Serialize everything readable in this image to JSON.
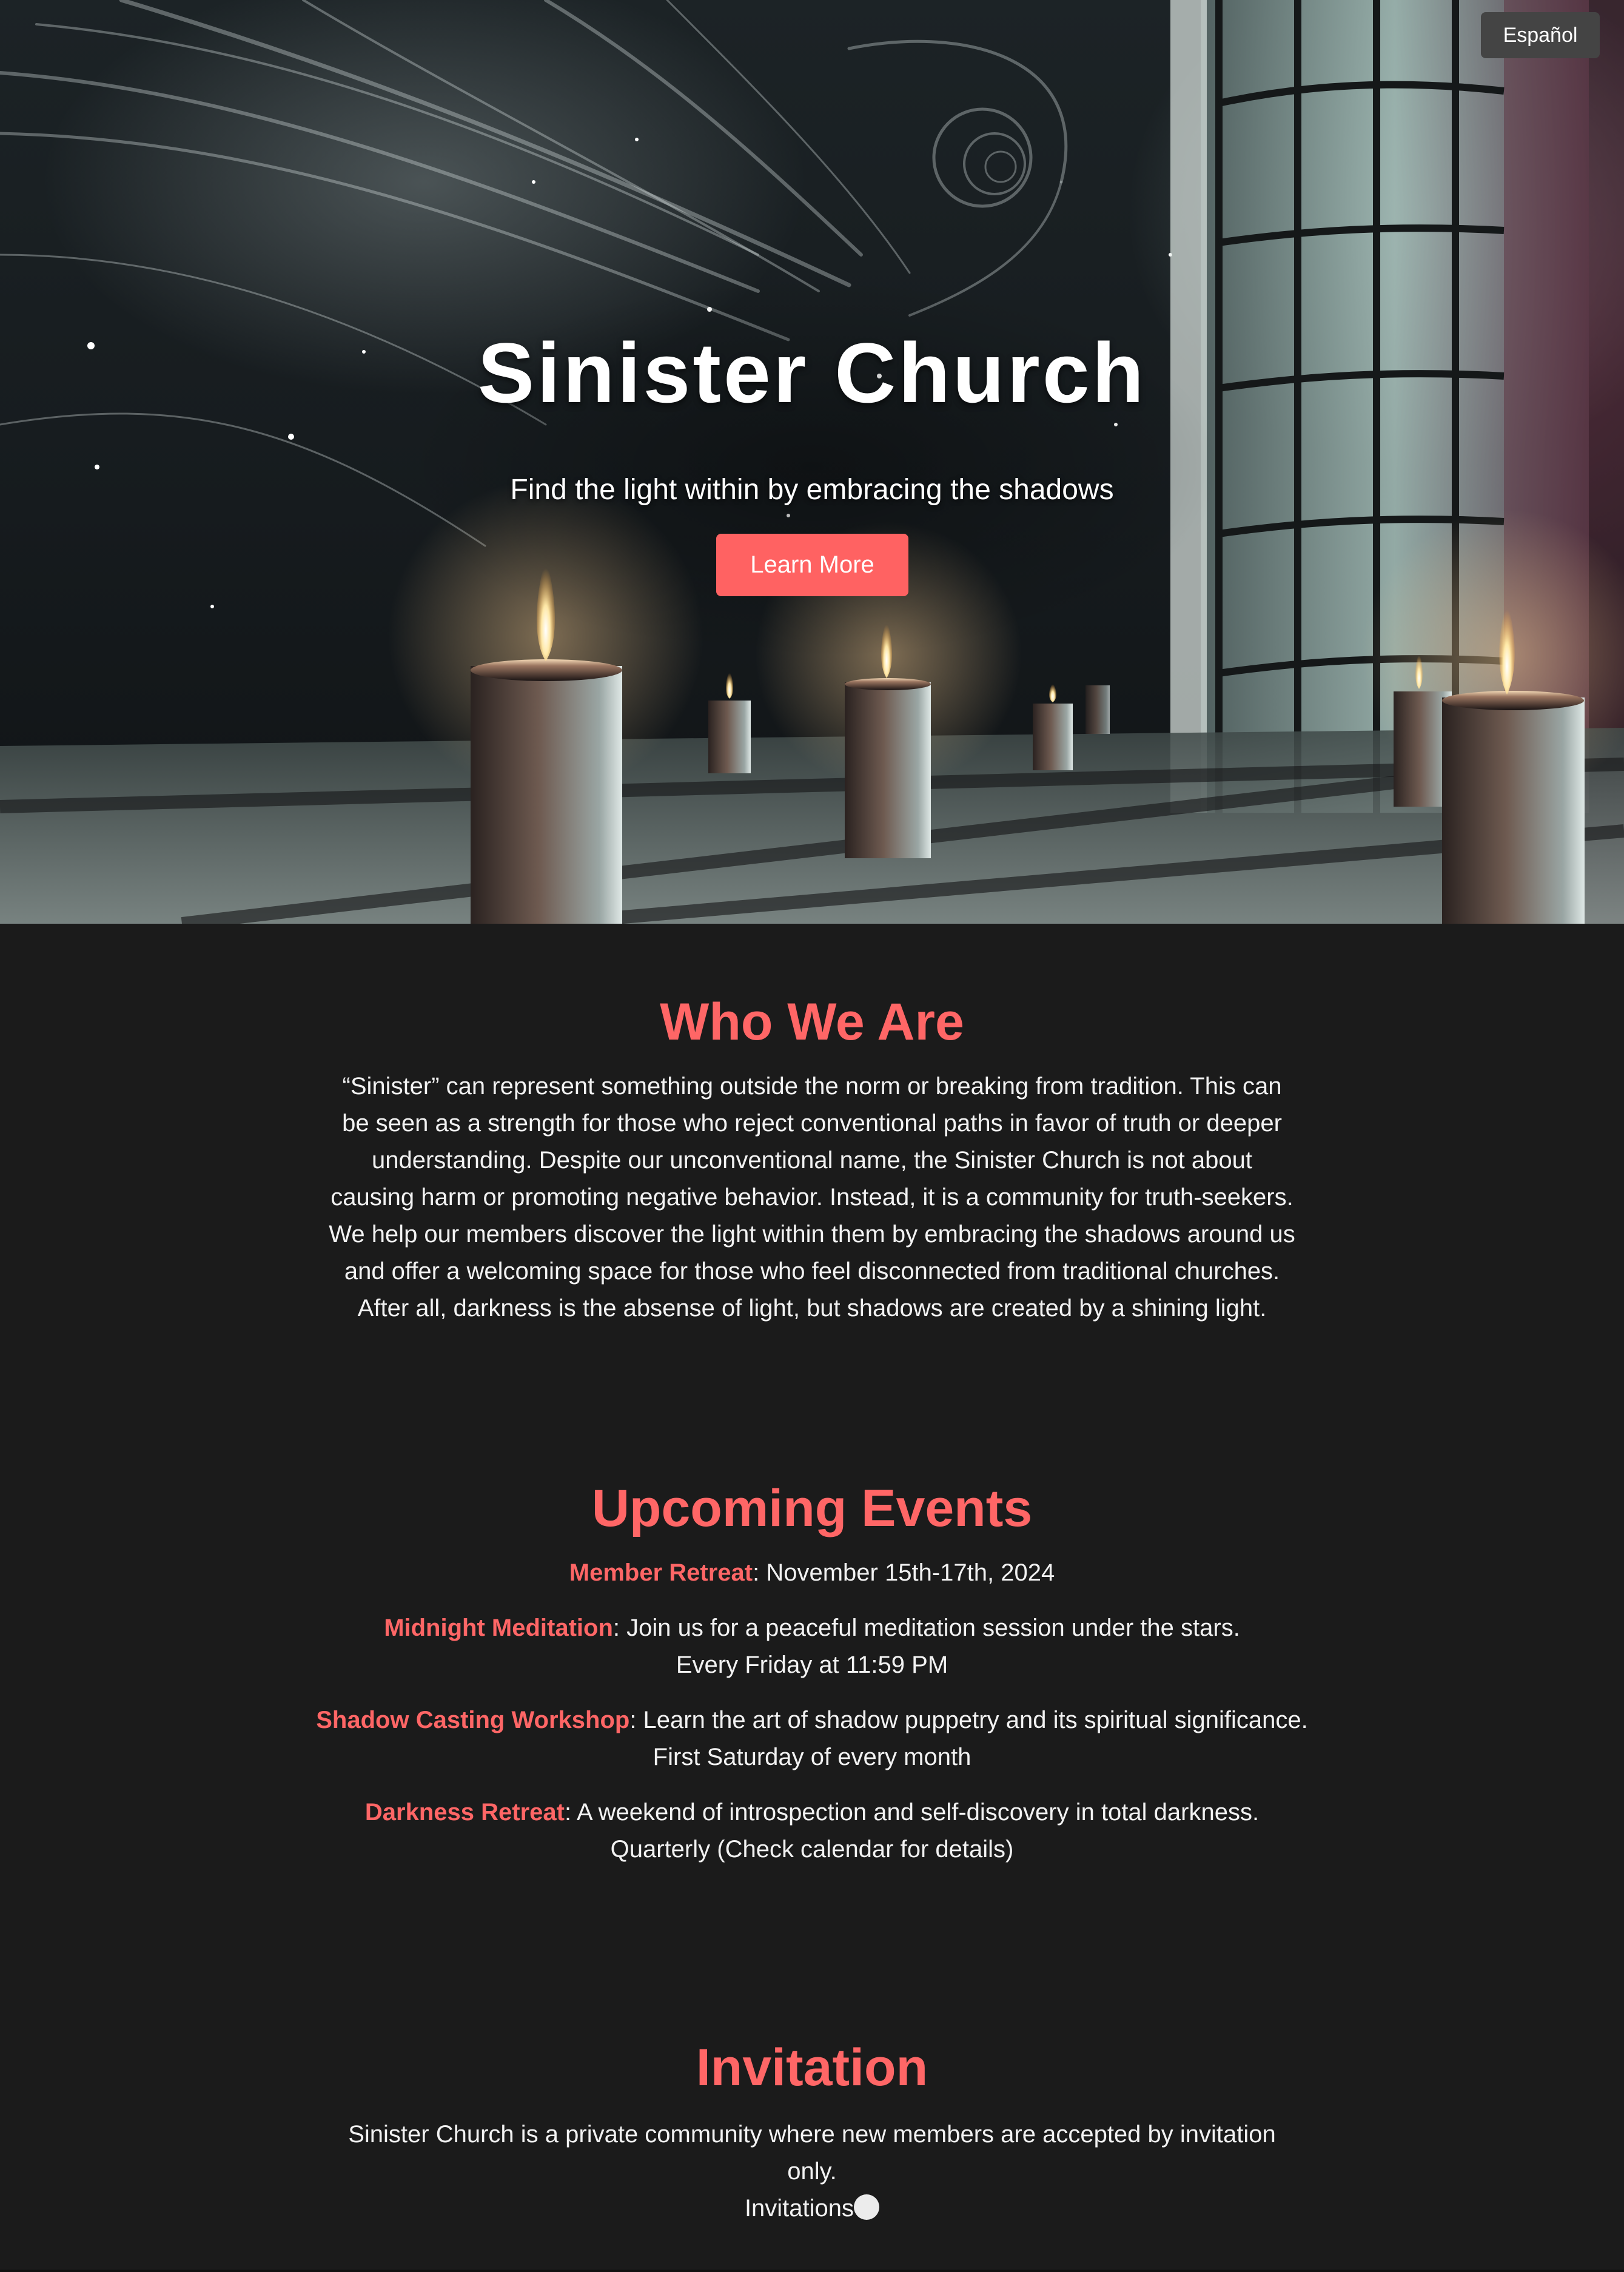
{
  "lang_toggle": {
    "label": "Español"
  },
  "hero": {
    "title": "Sinister Church",
    "subtitle": "Find the light within by embracing the shadows",
    "cta_label": "Learn More"
  },
  "about": {
    "heading": "Who We Are",
    "body": "“Sinister” can represent something outside the norm or breaking from tradition. This can be seen as a strength for those who reject conventional paths in favor of truth or deeper understanding. Despite our unconventional name, the Sinister Church is not about causing harm or promoting negative behavior. Instead, it is a community for truth-seekers. We help our members discover the light within them by embracing the shadows around us and offer a welcoming space for those who feel disconnected from traditional churches. After all, darkness is the absense of light, but shadows are created by a shining light."
  },
  "events": {
    "heading": "Upcoming Events",
    "items": [
      {
        "name": "Member Retreat",
        "description": "November 15th-17th, 2024",
        "schedule": ""
      },
      {
        "name": "Midnight Meditation",
        "description": "Join us for a peaceful meditation session under the stars.",
        "schedule": "Every Friday at 11:59 PM"
      },
      {
        "name": "Shadow Casting Workshop",
        "description": "Learn the art of shadow puppetry and its spiritual significance.",
        "schedule": "First Saturday of every month"
      },
      {
        "name": "Darkness Retreat",
        "description": "A weekend of introspection and self-discovery in total darkness.",
        "schedule": "Quarterly (Check calendar for details)"
      }
    ]
  },
  "invitation": {
    "heading": "Invitation",
    "body": "Sinister Church is a private community where new members are accepted by invitation only.",
    "link_label": "Invitations"
  },
  "colors": {
    "accent": "#ff6666",
    "background": "#1b1b1b",
    "cta": "#ff6262",
    "lang_button": "#444444",
    "text": "#f2f2f2"
  },
  "icons": {
    "invitation_toggle": "circle-toggle-icon"
  }
}
